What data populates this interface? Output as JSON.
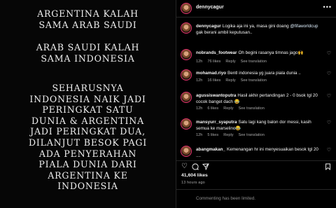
{
  "post_image": {
    "paragraph1": "ARGENTINA KALAH\nSAMA ARAB SAUDI",
    "paragraph2": "ARAB SAUDI KALAH\nSAMA INDONESIA",
    "paragraph3": "SEHARUSNYA\nINDONESIA NAIK JADI\nPERINGKAT SATU\nDUNIA & ARGENTINA\nJADI PERINGKAT DUA,\nDILANJUT BESOK PAGI\nADA PENYERAHAN\nPIALA DUNIA DARI\nARGENTINA KE\nINDONESIA"
  },
  "header": {
    "username": "dennycagur",
    "more_icon": "more-icon"
  },
  "caption": {
    "username": "dennycagur",
    "text_before": "Logika aja ini ya, masa gini doang ",
    "mention": "@fifaworldcup",
    "text_after": " gak berani ambil keputusan.."
  },
  "comments": [
    {
      "username": "nobrands_footwear",
      "text": "Oh begini rasanya timnas jago🙌",
      "time": "12h",
      "likes": "76 likes",
      "reply": "Reply",
      "translation": "See translation"
    },
    {
      "username": "mohamad.riyo",
      "text": "Bentl indonesia yg juara piala dunia ..",
      "time": "12h",
      "likes": "16 likes",
      "reply": "Reply",
      "translation": "See translation"
    },
    {
      "username": "agussiswantoputra",
      "text": "Hasil akhir pertandingan 2 - 0 bsok tgl 20 cocok banget dach 😂",
      "time": "12h",
      "likes": "6 likes",
      "reply": "Reply",
      "translation": "See translation"
    },
    {
      "username": "mansyurr_syaputra",
      "text": "Satu lagi kang balon dor messi, kasih semua ke marselino😂",
      "time": "12h",
      "likes": "5 likes",
      "reply": "Reply",
      "translation": "See translation"
    },
    {
      "username": "abangmakan_",
      "text": "Kemenangan hr ini menyesuaikan besok tgl 20 ....",
      "time": "",
      "likes": "",
      "reply": "",
      "translation": ""
    }
  ],
  "likes": "41,604 likes",
  "time_ago": "13 hours ago",
  "commenting_disabled": "Commenting has been limited."
}
